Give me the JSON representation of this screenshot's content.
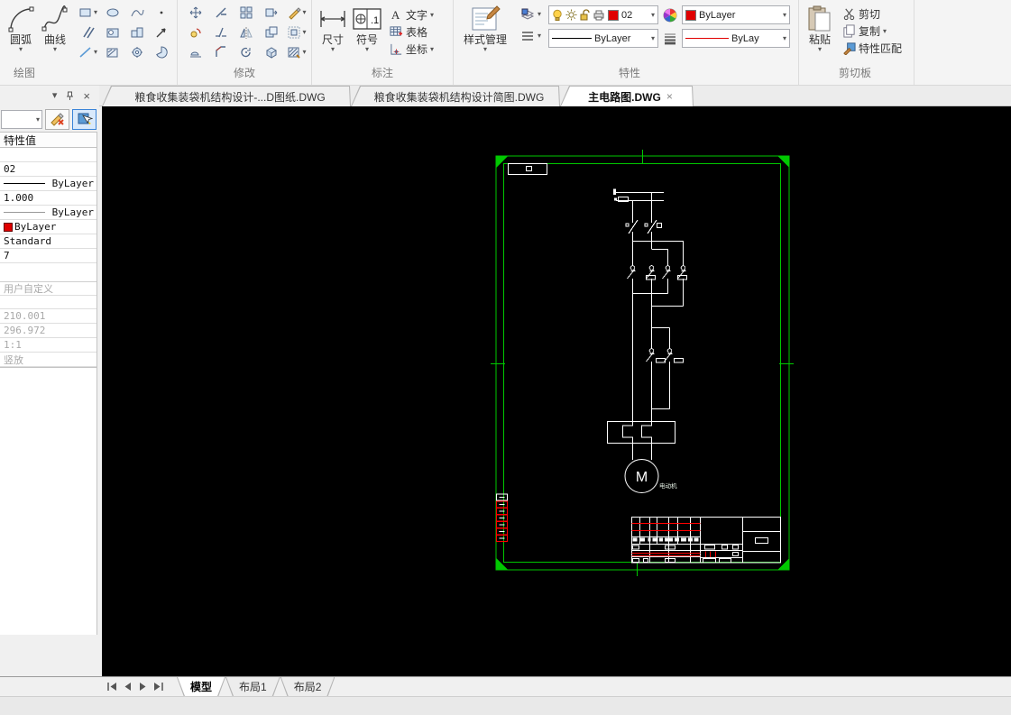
{
  "ribbon": {
    "draw": {
      "label": "绘图",
      "arc": "圆弧",
      "curve": "曲线"
    },
    "modify": {
      "label": "修改"
    },
    "annotate": {
      "label": "标注",
      "dimension": "尺寸",
      "symbol": "符号",
      "text": "文字",
      "table": "表格",
      "coordinate": "坐标"
    },
    "properties": {
      "label": "特性",
      "style_manager": "样式管理",
      "layer_name": "02",
      "color_value": "ByLayer",
      "linetype_value": "ByLayer",
      "lineweight_value": "ByLay"
    },
    "clipboard": {
      "label": "剪切板",
      "paste": "粘贴",
      "cut": "剪切",
      "copy": "复制",
      "match_properties": "特性匹配"
    }
  },
  "doc_tabs": [
    {
      "label": "粮食收集装袋机结构设计-...D图纸.DWG",
      "active": false
    },
    {
      "label": "粮食收集装袋机结构设计简图.DWG",
      "active": false
    },
    {
      "label": "主电路图.DWG",
      "active": true
    }
  ],
  "properties_panel": {
    "title": "特性值",
    "combo_value": "",
    "rows": [
      {
        "value": ""
      },
      {
        "value": "02"
      },
      {
        "value": "ByLayer",
        "kind": "linetype"
      },
      {
        "value": "1.000"
      },
      {
        "value": "ByLayer",
        "kind": "linetype-thin"
      },
      {
        "value": "ByLayer",
        "kind": "color"
      },
      {
        "value": "Standard"
      },
      {
        "value": "7"
      }
    ],
    "group_row": "用户自定义",
    "disabled_rows": [
      {
        "value": "210.001"
      },
      {
        "value": "296.972"
      },
      {
        "value": "1:1"
      },
      {
        "value": "竖放"
      }
    ]
  },
  "canvas": {
    "motor_symbol": "M",
    "motor_label": "电动机"
  },
  "layout_tabs": {
    "model": "模型",
    "layout1": "布局1",
    "layout2": "布局2"
  },
  "glyphs": {
    "dropdown": "▾",
    "close": "×"
  },
  "colors": {
    "frame_green": "#00c800",
    "circuit_white": "#ffffff",
    "accent_red": "#ff0000",
    "layer_swatch_red": "#e00000",
    "canvas_black": "#000000"
  }
}
